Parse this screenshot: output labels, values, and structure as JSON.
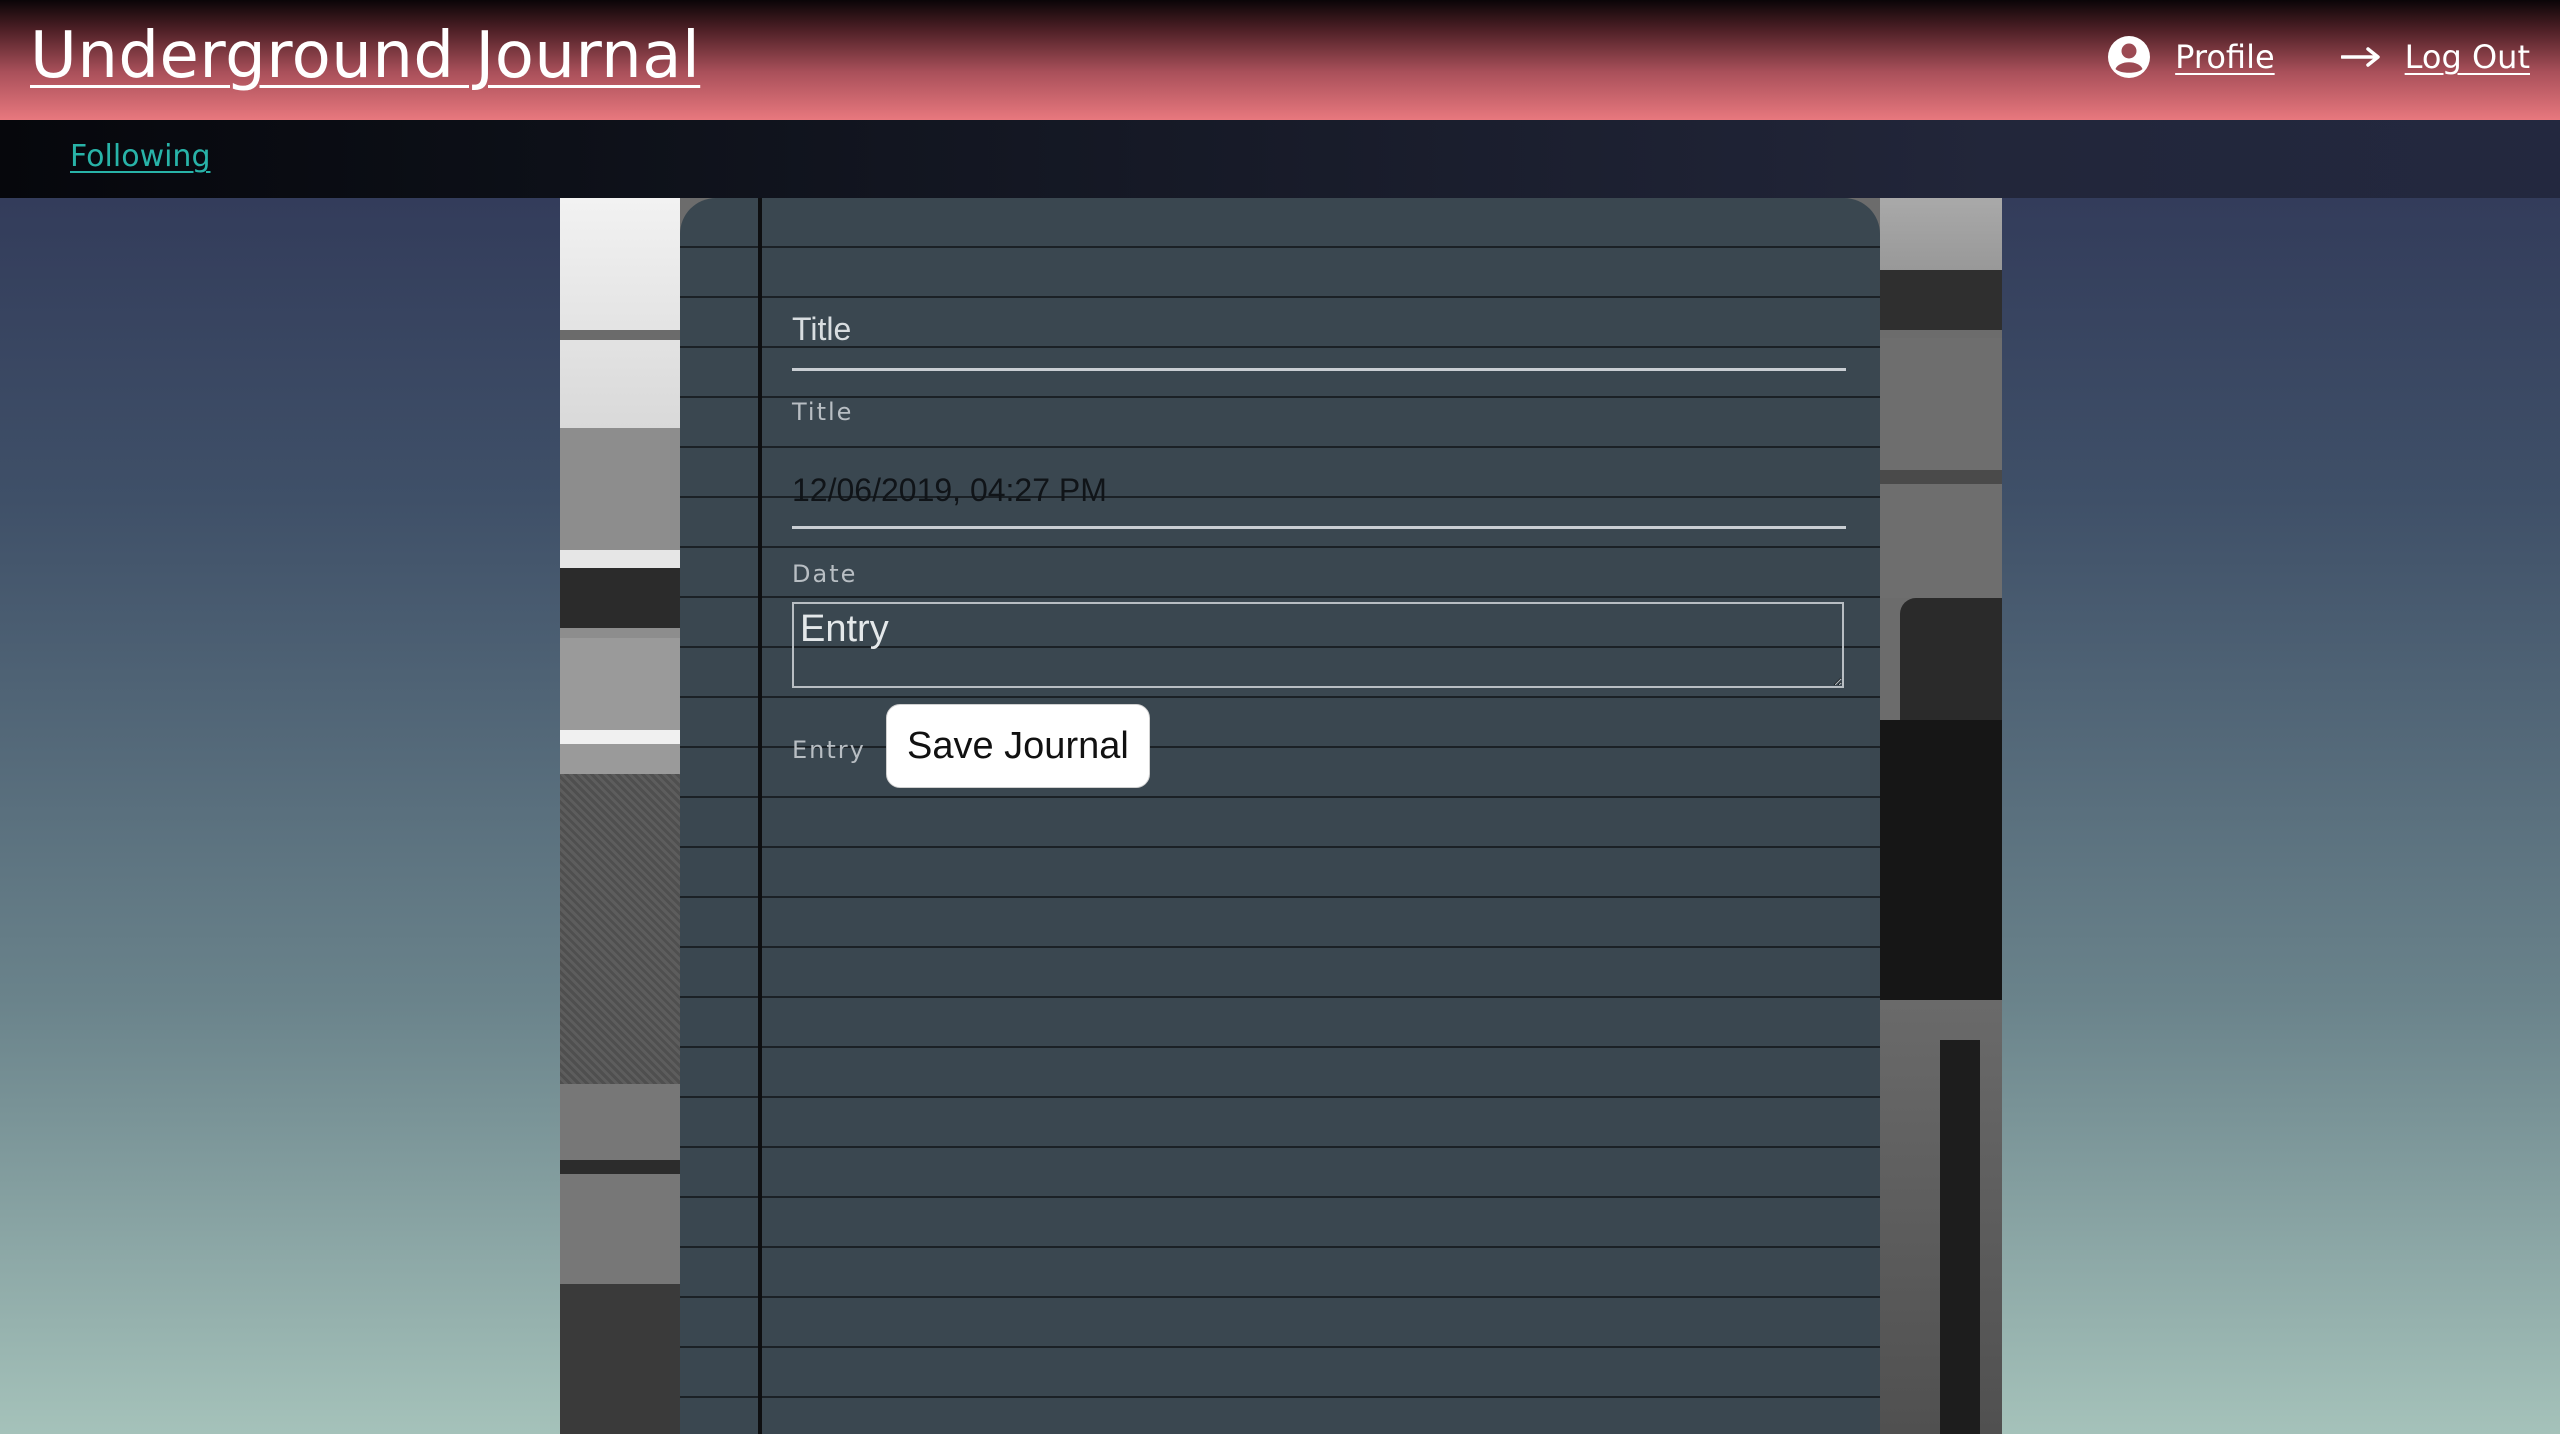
{
  "header": {
    "title": "Underground Journal",
    "profile_label": "Profile",
    "profile_icon": "user-circle-icon",
    "logout_label": "Log Out",
    "logout_icon": "arrow-right-icon"
  },
  "subnav": {
    "following_label": "Following"
  },
  "form": {
    "title_placeholder": "Title",
    "title_label": "Title",
    "date_value": "12/06/2019, 04:27 PM",
    "date_label": "Date",
    "entry_placeholder": "Entry",
    "entry_label": "Entry",
    "save_label": "Save Journal"
  },
  "colors": {
    "header_accent": "#e8787e",
    "link_teal": "#28b3a8",
    "notebook": "#3a4750"
  }
}
